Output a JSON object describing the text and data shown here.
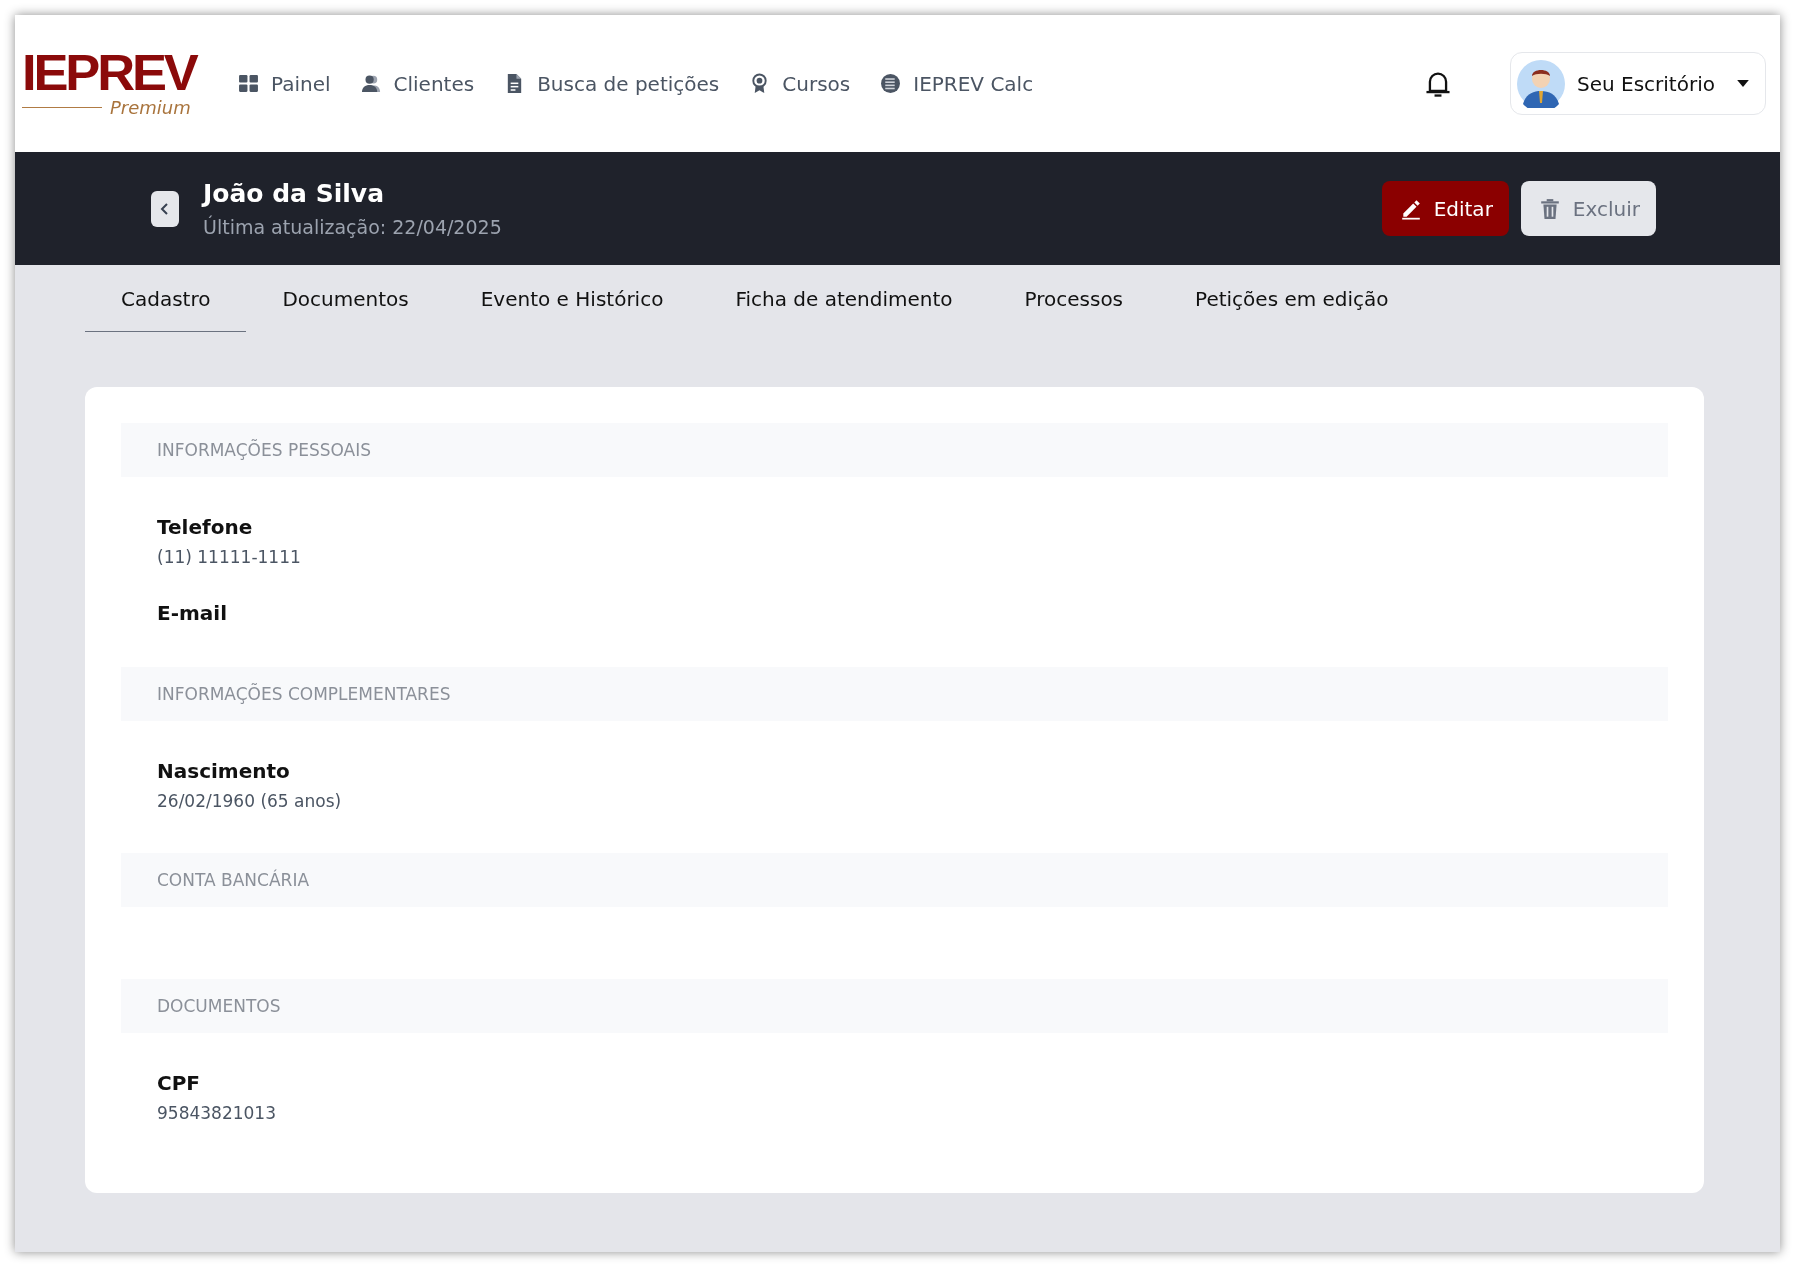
{
  "brand": {
    "name": "IEPREV",
    "tagline": "Premium"
  },
  "nav": [
    {
      "label": "Painel",
      "kind": "grid"
    },
    {
      "label": "Clientes",
      "kind": "users"
    },
    {
      "label": "Busca de petições",
      "kind": "file"
    },
    {
      "label": "Cursos",
      "kind": "award"
    },
    {
      "label": "IEPREV Calc",
      "kind": "calc"
    }
  ],
  "account": {
    "label": "Seu Escritório"
  },
  "client": {
    "name": "João da Silva",
    "updated": "Última atualização: 22/04/2025"
  },
  "actions": [
    {
      "label": "Editar",
      "kind": "primary"
    },
    {
      "label": "Excluir",
      "kind": "secondary"
    }
  ],
  "tabs": [
    {
      "label": "Cadastro",
      "selected": true
    },
    {
      "label": "Documentos",
      "selected": false
    },
    {
      "label": "Evento e Histórico",
      "selected": false
    },
    {
      "label": "Ficha de atendimento",
      "selected": false
    },
    {
      "label": "Processos",
      "selected": false
    },
    {
      "label": "Petições em edição",
      "selected": false
    }
  ],
  "sections": [
    {
      "title": "INFORMAÇÕES PESSOAIS",
      "fields": [
        {
          "label": "Telefone",
          "value": "(11) 11111-1111"
        },
        {
          "label": "E-mail"
        }
      ]
    },
    {
      "title": "INFORMAÇÕES COMPLEMENTARES",
      "fields": [
        {
          "label": "Nascimento",
          "value": "26/02/1960 (65 anos)"
        }
      ]
    },
    {
      "title": "CONTA BANCÁRIA"
    },
    {
      "title": "DOCUMENTOS",
      "fields": [
        {
          "label": "CPF",
          "value": "95843821013"
        }
      ]
    }
  ]
}
